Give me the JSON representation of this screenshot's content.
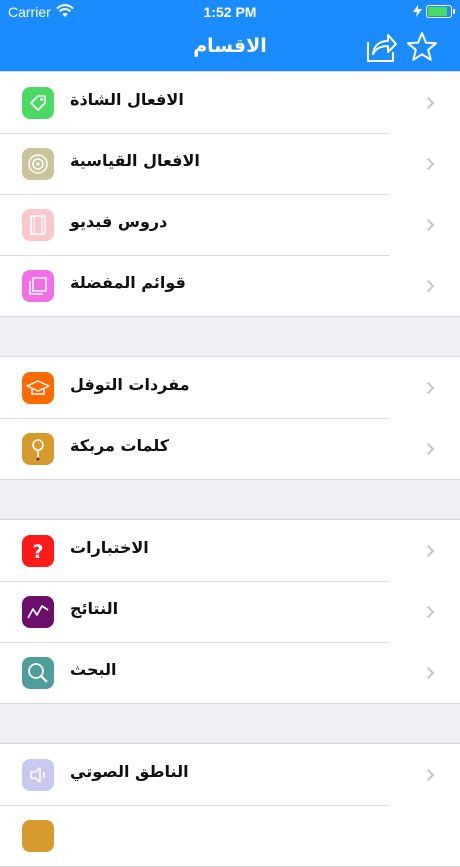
{
  "status": {
    "carrier": "Carrier",
    "time": "1:52 PM"
  },
  "nav": {
    "title": "الاقسام",
    "share_icon": "share-icon",
    "star_icon": "star-icon"
  },
  "colors": {
    "accent": "#1a8cff"
  },
  "groups": [
    {
      "items": [
        {
          "label": "الافعال الشاذة",
          "icon": "tag-icon",
          "color": "#4cd964"
        },
        {
          "label": "الافعال القياسية",
          "icon": "target-icon",
          "color": "#c9c49a"
        },
        {
          "label": "دروس فيديو",
          "icon": "film-icon",
          "color": "#f8c8cc"
        },
        {
          "label": "قوائم المفضلة",
          "icon": "photo-stack-icon",
          "color": "#f06fe6"
        }
      ]
    },
    {
      "items": [
        {
          "label": "مفردات التوفل",
          "icon": "graduation-cap-icon",
          "color": "#ff6a00"
        },
        {
          "label": "كلمات مربكة",
          "icon": "pin-icon",
          "color": "#d69a2d"
        }
      ]
    },
    {
      "items": [
        {
          "label": "الاختبارات",
          "icon": "question-icon",
          "color": "#ff1a1a"
        },
        {
          "label": "النتائج",
          "icon": "chart-line-icon",
          "color": "#6b0f6b"
        },
        {
          "label": "البحث",
          "icon": "magnifier-icon",
          "color": "#4f9e9a"
        }
      ]
    },
    {
      "items": [
        {
          "label": "الناطق الصوتي",
          "icon": "speaker-icon",
          "color": "#c8c8f0"
        }
      ]
    }
  ]
}
